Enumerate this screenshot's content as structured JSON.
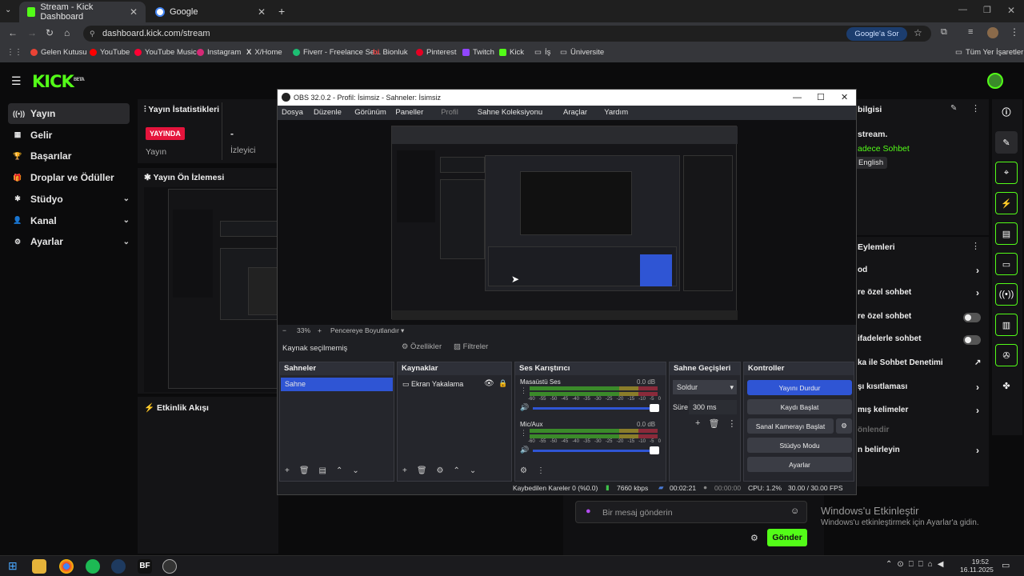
{
  "browser": {
    "tabs": [
      {
        "title": "Stream - Kick Dashboard",
        "active": true
      },
      {
        "title": "Google",
        "active": false
      }
    ],
    "url": "dashboard.kick.com/stream",
    "google_button": "Google'a Sor",
    "bookmarks": [
      "Gelen Kutusu",
      "YouTube",
      "YouTube Music",
      "Instagram",
      "X/Home",
      "Fiverr - Freelance Se...",
      "Bionluk",
      "Pinterest",
      "Twitch",
      "Kick",
      "İş",
      "Üniversite"
    ],
    "all_bookmarks": "Tüm Yer İşaretleri"
  },
  "kick": {
    "logo": "KICK",
    "logo_tag": "BETA",
    "nav": [
      {
        "label": "Yayın",
        "icon": "broadcast-icon",
        "selected": true,
        "chevron": false
      },
      {
        "label": "Gelir",
        "icon": "grid-icon",
        "selected": false,
        "chevron": false
      },
      {
        "label": "Başarılar",
        "icon": "trophy-icon",
        "selected": false,
        "chevron": false
      },
      {
        "label": "Droplar ve Ödüller",
        "icon": "gift-icon",
        "selected": false,
        "chevron": false
      },
      {
        "label": "Stüdyo",
        "icon": "studio-icon",
        "selected": false,
        "chevron": true
      },
      {
        "label": "Kanal",
        "icon": "channel-icon",
        "selected": false,
        "chevron": true
      },
      {
        "label": "Ayarlar",
        "icon": "gear-icon",
        "selected": false,
        "chevron": true
      }
    ],
    "stats_title": "Yayın İstatistikleri",
    "live_badge": "YAYINDA",
    "live_label": "Yayın",
    "viewers_value": "-",
    "viewers_label": "İzleyici",
    "preview_title": "Yayın Ön İzlemesi",
    "activity_title": "Etkinlik Akışı",
    "info_title": "bilgisi",
    "info_line": "stream.",
    "chat_mode": "adece Sohbet",
    "language": "English",
    "actions_title": "Eylemleri",
    "actions": [
      {
        "label": "od",
        "control": "chevron"
      },
      {
        "label": "re özel sohbet",
        "control": "chevron"
      },
      {
        "label": "re özel sohbet",
        "control": "toggle"
      },
      {
        "label": "ifadelerle sohbet",
        "control": "toggle"
      },
      {
        "label": "ka ile Sohbet Denetimi",
        "control": "external"
      },
      {
        "label": "şı kısıtlaması",
        "control": "chevron"
      },
      {
        "label": "mış kelimeler",
        "control": "chevron"
      },
      {
        "label": "önlendir",
        "control": "none"
      },
      {
        "label": "n belirleyin",
        "control": "chevron"
      }
    ],
    "chat_placeholder": "Bir mesaj gönderin",
    "send_label": "Gönder",
    "watermark_title": "Windows'u Etkinleştir",
    "watermark_sub": "Windows'u etkinleştirmek için Ayarlar'a gidin."
  },
  "obs": {
    "title": "OBS 32.0.2 - Profil: İsimsiz - Sahneler: İsimsiz",
    "menu": [
      "Dosya",
      "Düzenle",
      "Görünüm",
      "Paneller",
      "Profil",
      "Sahne Koleksiyonu",
      "Araçlar",
      "Yardım"
    ],
    "zoom": "33%",
    "fit_label": "Pencereye Boyutlandır",
    "no_source": "Kaynak seçilmemiş",
    "properties": "Özellikler",
    "filters": "Filtreler",
    "scenes_title": "Sahneler",
    "scenes": [
      "Sahne"
    ],
    "sources_title": "Kaynaklar",
    "sources": [
      "Ekran Yakalama"
    ],
    "mixer_title": "Ses Karıştırıcı",
    "mixer": [
      {
        "name": "Masaüstü Ses",
        "db": "0.0 dB"
      },
      {
        "name": "Mic/Aux",
        "db": "0.0 dB"
      }
    ],
    "meter_ticks": [
      "-60",
      "-55",
      "-50",
      "-45",
      "-40",
      "-35",
      "-30",
      "-25",
      "-20",
      "-15",
      "-10",
      "-5",
      "0"
    ],
    "transitions_title": "Sahne Geçişleri",
    "transition": "Soldur",
    "duration_label": "Süre",
    "duration": "300 ms",
    "controls_title": "Kontroller",
    "controls": [
      "Yayını Durdur",
      "Kaydı Başlat",
      "Sanal Kamerayı Başlat",
      "Stüdyo Modu",
      "Ayarlar"
    ],
    "status": {
      "dropped": "Kaybedilen Kareler 0 (%0.0)",
      "bitrate": "7660 kbps",
      "stream_time": "00:02:21",
      "rec_time": "00:00:00",
      "cpu": "CPU: 1.2%",
      "fps": "30.00 / 30.00 FPS"
    }
  },
  "taskbar": {
    "time": "19:52",
    "date": "16.11.2025"
  },
  "colors": {
    "kick_green": "#53fc18",
    "obs_blue": "#2f55d4",
    "live_red": "#e5143c"
  }
}
